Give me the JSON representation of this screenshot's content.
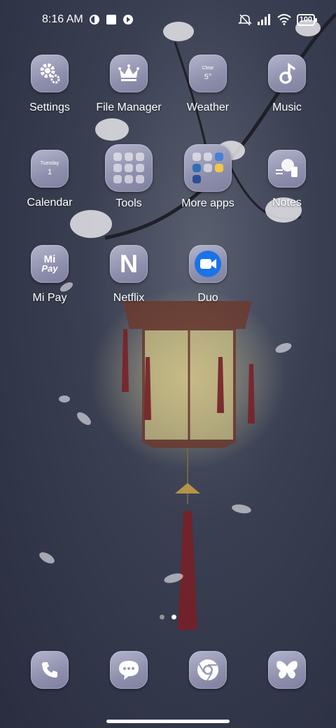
{
  "status_bar": {
    "time": "8:16 AM",
    "battery": "100",
    "icons": [
      "app-notification-icon",
      "square-notification-icon",
      "app-notification-icon-2",
      "mute-icon",
      "signal-icon",
      "wifi-icon",
      "battery-icon"
    ]
  },
  "weather_widget": {
    "condition": "Clear",
    "temperature": "5°"
  },
  "calendar_widget": {
    "weekday": "Tuesday",
    "day": "1"
  },
  "mipay_icon": {
    "line1": "Mi",
    "line2": "Pay"
  },
  "netflix_icon": {
    "letter": "N"
  },
  "apps": [
    {
      "label": "Settings",
      "icon": "gear-icon"
    },
    {
      "label": "File Manager",
      "icon": "crown-icon"
    },
    {
      "label": "Weather",
      "icon": "weather-icon"
    },
    {
      "label": "Music",
      "icon": "music-note-icon"
    },
    {
      "label": "Calendar",
      "icon": "calendar-icon"
    },
    {
      "label": "Tools",
      "icon": "folder-icon"
    },
    {
      "label": "More apps",
      "icon": "folder-icon"
    },
    {
      "label": "Notes",
      "icon": "notes-icon"
    },
    {
      "label": "Mi Pay",
      "icon": "mi-pay-icon"
    },
    {
      "label": "Netflix",
      "icon": "netflix-icon"
    },
    {
      "label": "Duo",
      "icon": "video-camera-icon"
    }
  ],
  "dock": [
    {
      "icon": "phone-icon"
    },
    {
      "icon": "messages-icon"
    },
    {
      "icon": "chrome-icon"
    },
    {
      "icon": "butterfly-icon"
    }
  ],
  "page_indicator": {
    "pages": 2,
    "current": 2
  },
  "colors": {
    "icon_bg": "#9a9bb7",
    "duo_blue": "#1a73e8",
    "background": "#33374a"
  }
}
